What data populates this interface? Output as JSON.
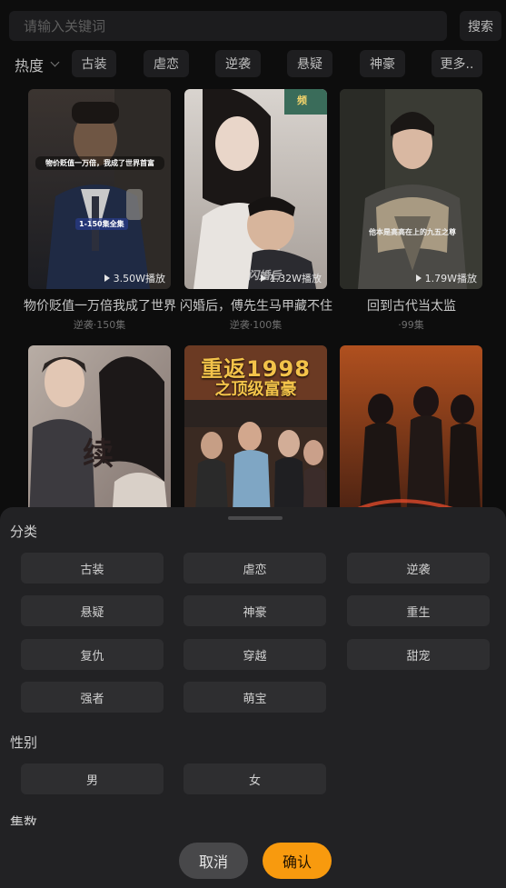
{
  "search": {
    "placeholder": "请输入关键词",
    "button_label": "搜索"
  },
  "filters": {
    "sort_label": "热度",
    "chips": [
      "古装",
      "虐恋",
      "逆袭",
      "悬疑",
      "神豪",
      "更多.."
    ]
  },
  "cards": [
    {
      "title": "物价贬值一万倍我成了世界",
      "meta": "逆袭·150集",
      "plays": "3.50W播放",
      "overlay_1": "物价贬值一万倍，我成了世界首富",
      "overlay_2": "1-150集全集"
    },
    {
      "title": "闪婚后，傅先生马甲藏不住",
      "meta": "逆袭·100集",
      "plays": "1.32W播放",
      "overlay_1": "闪婚后",
      "overlay_2": ""
    },
    {
      "title": "回到古代当太监",
      "meta": "·99集",
      "plays": "1.79W播放",
      "overlay_1": "他本是高高在上的九五之尊",
      "overlay_2": ""
    },
    {
      "title": "",
      "meta": "",
      "plays": "",
      "overlay_1": "续",
      "overlay_2": ""
    },
    {
      "title": "",
      "meta": "",
      "plays": "",
      "overlay_1": "重返1998",
      "overlay_2": "之顶级富豪"
    },
    {
      "title": "",
      "meta": "",
      "plays": "",
      "overlay_1": "",
      "overlay_2": ""
    }
  ],
  "sheet": {
    "category_title": "分类",
    "categories": [
      "古装",
      "虐恋",
      "逆袭",
      "悬疑",
      "神豪",
      "重生",
      "复仇",
      "穿越",
      "甜宠",
      "强者",
      "萌宝"
    ],
    "gender_title": "性别",
    "genders": [
      "男",
      "女"
    ],
    "episodes_title": "集数",
    "cancel_label": "取消",
    "confirm_label": "确认"
  },
  "colors": {
    "accent": "#f89a0e",
    "sheet_bg": "#222224",
    "option_bg": "#2e2e30"
  }
}
